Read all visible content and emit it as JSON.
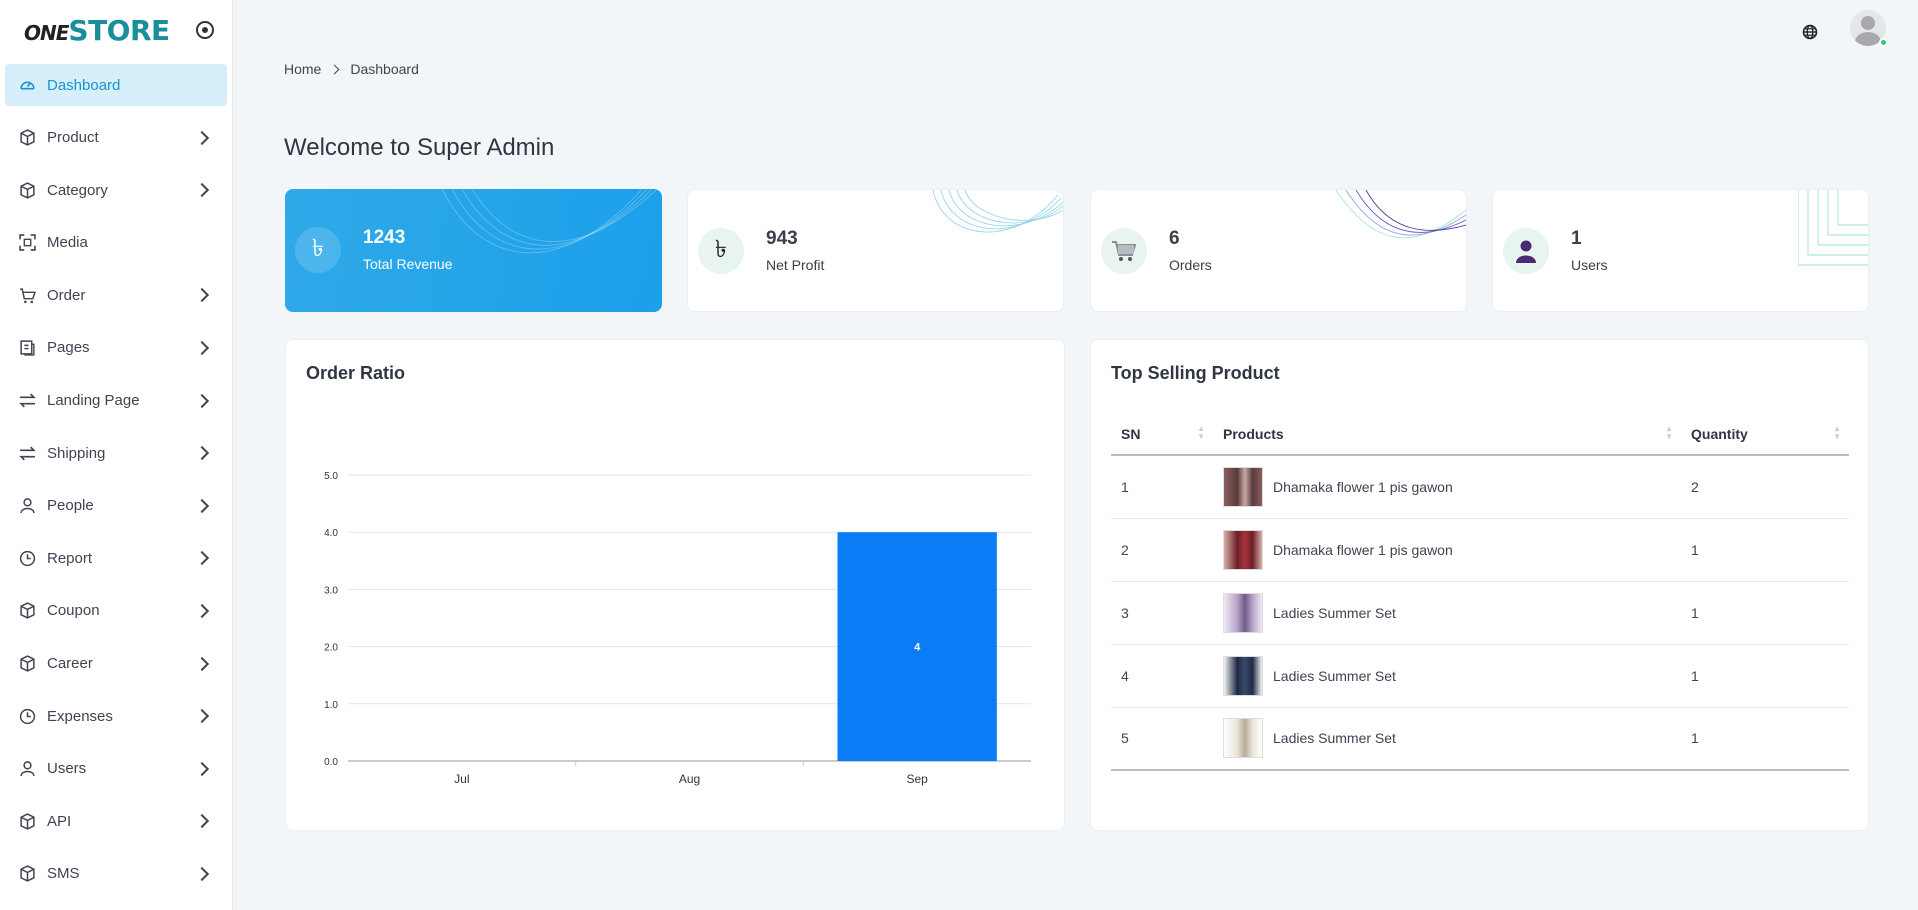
{
  "brand": {
    "logo_one": "ONE",
    "logo_store": "STORE"
  },
  "sidebar": {
    "items": [
      {
        "label": "Dashboard",
        "icon": "gauge-icon",
        "active": true,
        "has_arrow": false
      },
      {
        "label": "Product",
        "icon": "box-icon",
        "has_arrow": true
      },
      {
        "label": "Category",
        "icon": "box-icon",
        "has_arrow": true
      },
      {
        "label": "Media",
        "icon": "scan-icon",
        "has_arrow": false
      },
      {
        "label": "Order",
        "icon": "cart-icon",
        "has_arrow": true
      },
      {
        "label": "Pages",
        "icon": "pages-icon",
        "has_arrow": true
      },
      {
        "label": "Landing Page",
        "icon": "swap-icon",
        "has_arrow": true
      },
      {
        "label": "Shipping",
        "icon": "swap-icon",
        "has_arrow": true
      },
      {
        "label": "People",
        "icon": "person-icon",
        "has_arrow": true
      },
      {
        "label": "Report",
        "icon": "clock-icon",
        "has_arrow": true
      },
      {
        "label": "Coupon",
        "icon": "box-icon",
        "has_arrow": true
      },
      {
        "label": "Career",
        "icon": "box-icon",
        "has_arrow": true
      },
      {
        "label": "Expenses",
        "icon": "clock-icon",
        "has_arrow": true
      },
      {
        "label": "Users",
        "icon": "person-icon",
        "has_arrow": true
      },
      {
        "label": "API",
        "icon": "box-icon",
        "has_arrow": true
      },
      {
        "label": "SMS",
        "icon": "box-icon",
        "has_arrow": true
      }
    ]
  },
  "breadcrumb": {
    "home": "Home",
    "current": "Dashboard"
  },
  "welcome": "Welcome to Super Admin",
  "stats": [
    {
      "value": "1243",
      "label": "Total Revenue",
      "icon": "taka-icon"
    },
    {
      "value": "943",
      "label": "Net Profit",
      "icon": "taka-icon"
    },
    {
      "value": "6",
      "label": "Orders",
      "icon": "cart-icon"
    },
    {
      "value": "1",
      "label": "Users",
      "icon": "user-icon"
    }
  ],
  "icons": {
    "taka": "৳"
  },
  "order_ratio": {
    "title": "Order Ratio"
  },
  "chart_data": {
    "type": "bar",
    "title": "Order Ratio",
    "categories": [
      "Jul",
      "Aug",
      "Sep"
    ],
    "values": [
      0,
      0,
      4
    ],
    "data_labels": [
      "",
      "",
      "4"
    ],
    "ylim": [
      0,
      5
    ],
    "yticks": [
      "0.0",
      "1.0",
      "2.0",
      "3.0",
      "4.0",
      "5.0"
    ],
    "grid": true,
    "bar_color": "#0a7cf5"
  },
  "top_selling": {
    "title": "Top Selling Product",
    "columns": [
      "SN",
      "Products",
      "Quantity"
    ],
    "rows": [
      {
        "sn": "1",
        "product": "Dhamaka flower 1 pis gawon",
        "qty": "2"
      },
      {
        "sn": "2",
        "product": "Dhamaka flower 1 pis gawon",
        "qty": "1"
      },
      {
        "sn": "3",
        "product": "Ladies Summer Set",
        "qty": "1"
      },
      {
        "sn": "4",
        "product": "Ladies Summer Set",
        "qty": "1"
      },
      {
        "sn": "5",
        "product": "Ladies Summer Set",
        "qty": "1"
      }
    ]
  },
  "colors": {
    "accent": "#1894cf",
    "active_bg": "#d7effb",
    "revenue_card": "#1ba0ea",
    "online": "#2ecc71"
  }
}
